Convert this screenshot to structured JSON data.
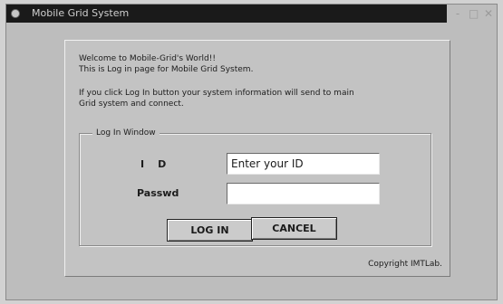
{
  "window": {
    "title": "Mobile Grid System",
    "icon": "app-icon",
    "controls": {
      "minimize": "-",
      "maximize": "□",
      "close": "✕"
    }
  },
  "panel": {
    "welcome_line1": "Welcome to Mobile-Grid's World!!",
    "welcome_line2": "This is Log in page for Mobile Grid System.",
    "info_line1": "If you click Log In button your system information will send to main",
    "info_line2": "Grid system and connect.",
    "login_group": {
      "legend": "Log In Window",
      "id_label": "ID",
      "id_value": "Enter your ID",
      "password_label": "Passwd",
      "password_value": ""
    },
    "buttons": {
      "login": "LOG IN",
      "cancel": "CANCEL"
    },
    "copyright": "Copyright IMTLab."
  },
  "colors": {
    "title_bar": "#1a1a1a",
    "window_background": "#bdbdbd",
    "panel_background": "#c3c3c3"
  }
}
